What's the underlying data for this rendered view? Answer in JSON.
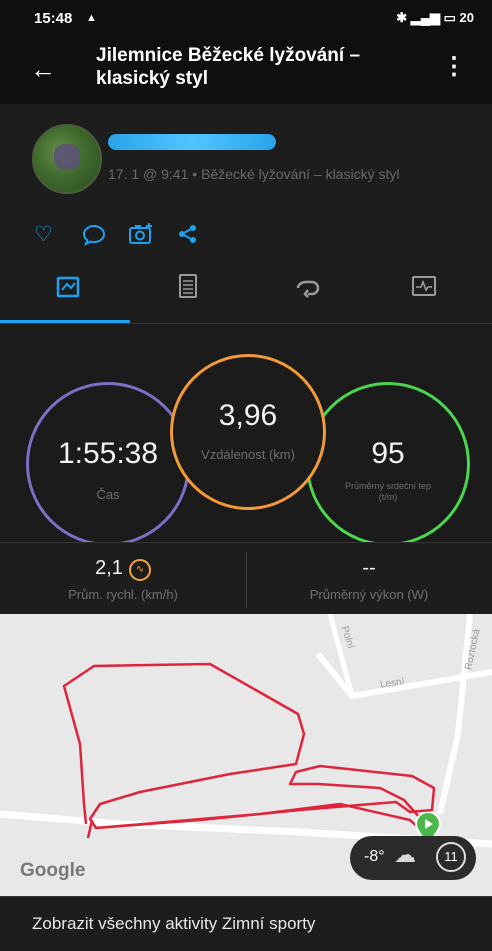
{
  "status_bar": {
    "time": "15:48",
    "right_text": "20"
  },
  "app_bar": {
    "title": "Jilemnice Běžecké lyžování – klasický styl"
  },
  "profile": {
    "subtitle": "17. 1 @ 9:41 • Běžecké lyžování – klasický styl"
  },
  "stats": {
    "time": {
      "value": "1:55:38",
      "label": "Čas"
    },
    "distance": {
      "value": "3,96",
      "label": "Vzdálenost (km)"
    },
    "heart_rate": {
      "value": "95",
      "label": "Průměrný srdeční tep (t/m)"
    }
  },
  "metrics": {
    "speed": {
      "value": "2,1",
      "label": "Prům. rychl. (km/h)"
    },
    "power": {
      "value": "--",
      "label": "Průměrný výkon (W)"
    }
  },
  "map": {
    "street_labels": [
      "Polní",
      "Lesní",
      "Roztocká"
    ],
    "google_label": "Google",
    "weather": {
      "temperature": "-8°",
      "wind": "11"
    }
  },
  "footer": {
    "link_text": "Zobrazit všechny aktivity Zimní sporty"
  },
  "colors": {
    "accent": "#1da1f2",
    "time_ring": "#7b70c6",
    "distance_ring": "#f29a3a",
    "heart_ring": "#4cd64f",
    "track": "#e0243c"
  },
  "icons": [
    "back-arrow-icon",
    "more-vert-icon",
    "heart-icon",
    "comment-icon",
    "camera-icon",
    "share-icon",
    "stats-tab-icon",
    "details-tab-icon",
    "laps-tab-icon",
    "chart-tab-icon",
    "speed-gauge-icon",
    "location-pin-icon",
    "weather-cloud-icon"
  ]
}
